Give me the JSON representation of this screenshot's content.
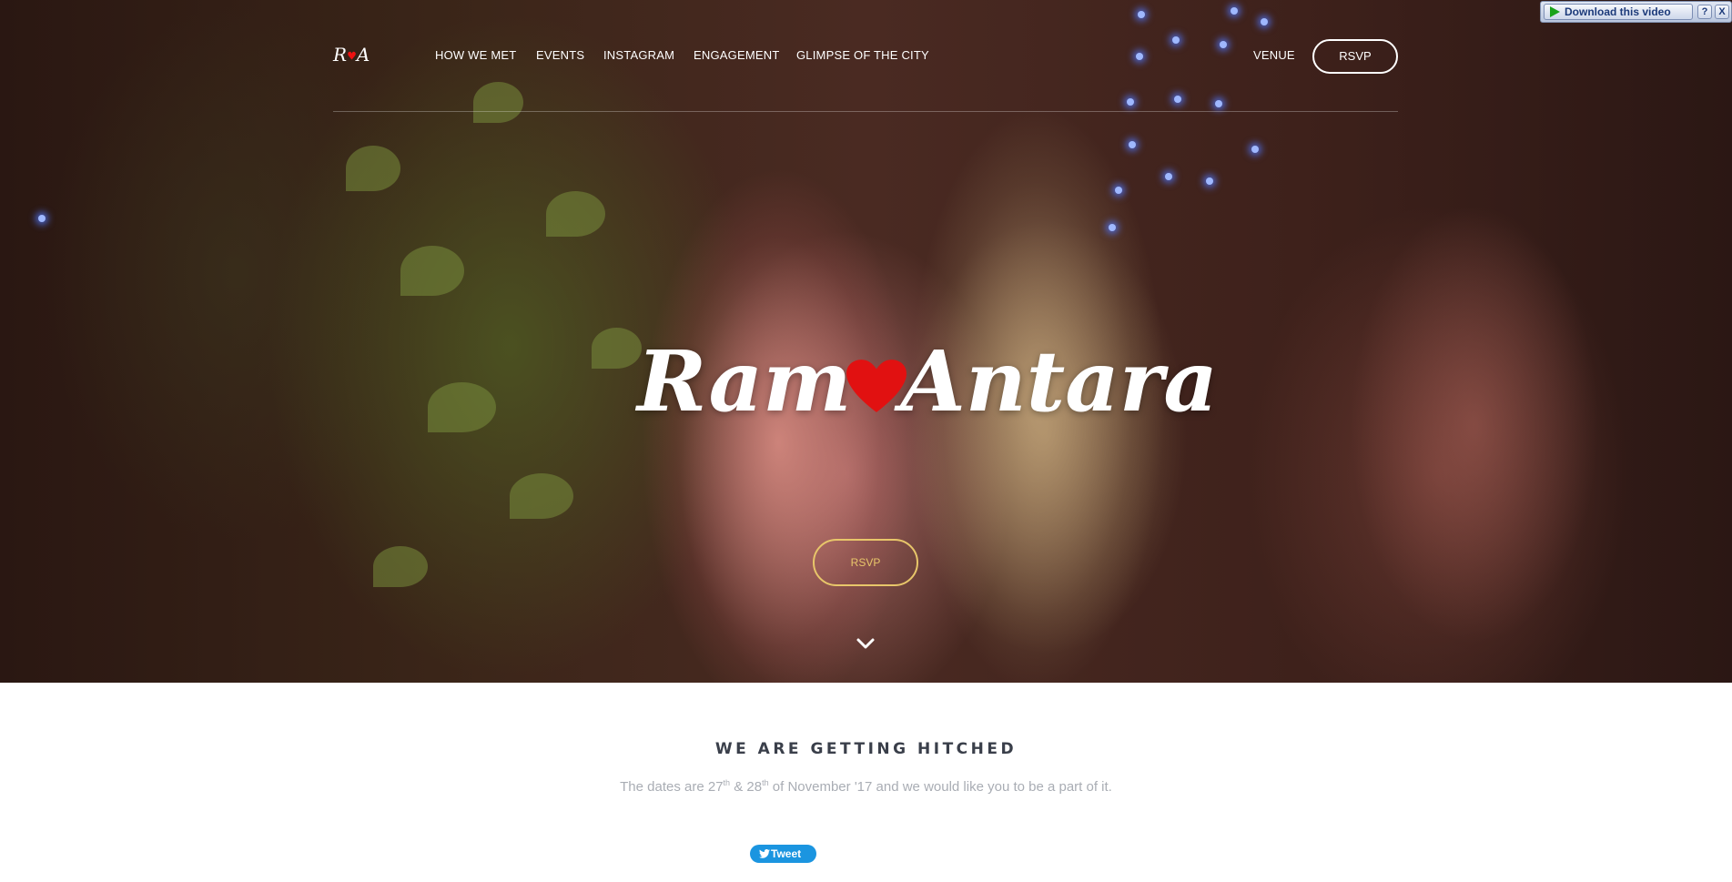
{
  "nav": {
    "logo": {
      "left": "R",
      "right": "A"
    },
    "links": [
      "HOW WE MET",
      "EVENTS",
      "INSTAGRAM",
      "ENGAGEMENT",
      "GLIMPSE OF THE CITY"
    ],
    "venue": "VENUE",
    "rsvp": "RSVP"
  },
  "hero": {
    "name_left": "Ram",
    "name_right": "Antara",
    "rsvp": "RSVP"
  },
  "download_bar": {
    "label": "Download this video",
    "help": "?",
    "close": "X"
  },
  "section": {
    "title": "WE ARE GETTING HITCHED",
    "subtitle_1": "The dates are 27",
    "sup_1": "th",
    "subtitle_2": " & 28",
    "sup_2": "th",
    "subtitle_3": " of November '17 and we would like you to be a part of it."
  },
  "tweet": {
    "label": "Tweet"
  },
  "colors": {
    "accent_gold": "#e8c66a",
    "heart": "#e11111",
    "tweet": "#1b95e0"
  },
  "icons": [
    "heart-icon",
    "chevron-down-icon",
    "play-icon",
    "twitter-bird-icon"
  ]
}
